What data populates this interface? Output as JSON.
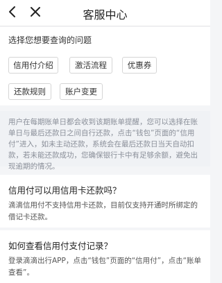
{
  "header": {
    "title": "客服中心"
  },
  "question_panel": {
    "prompt": "选择您想要查询的问题",
    "tags": [
      "信用付介绍",
      "激活流程",
      "优惠券",
      "还款规则",
      "账户变更"
    ]
  },
  "info_text": "用户在每期账单日都会收到该期账单提醒，您可以选择在账单日与最后还款日之间自行还款，点击“钱包”页面的“信用付”进入，如未主动还款，系统会在最后还款日当天自动扣款，若未能还款成功，您确保银行卡中有足够余额，避免出现逾期的情况。",
  "faqs": [
    {
      "question": "信用付可以用信用卡还款吗？",
      "answer": "滴滴信用付不支持信用卡还款，目前仅支持开通时所绑定的借记卡还款。"
    },
    {
      "question": "如何查看信用付支付记录？",
      "answer": "登录滴滴出行APP，点击“钱包”页面的“信用付”，点击“账单查看”。"
    }
  ]
}
